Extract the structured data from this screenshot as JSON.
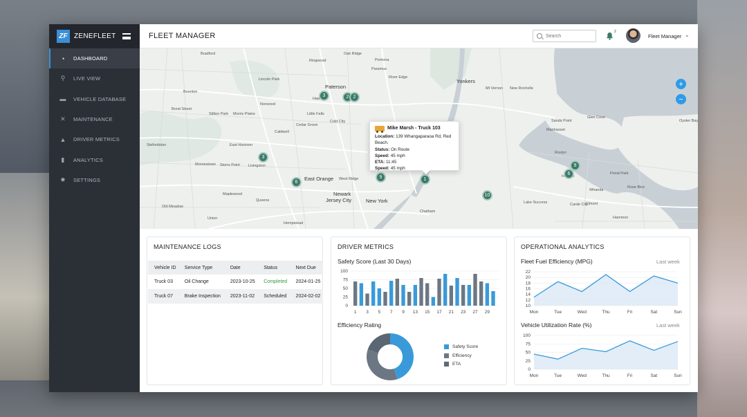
{
  "app": {
    "brand": "ZENEFLEET",
    "logo_text": "ZF",
    "page_title": "FLEET MANAGER"
  },
  "sidebar": {
    "items": [
      {
        "label": "DASHBOARD",
        "icon": "gauge-icon",
        "active": true
      },
      {
        "label": "LIVE VIEW",
        "icon": "route-icon"
      },
      {
        "label": "VEHICLE DATABASE",
        "icon": "truck-icon"
      },
      {
        "label": "MAINTENANCE",
        "icon": "tools-icon"
      },
      {
        "label": "DRIVER METRICS",
        "icon": "flask-icon"
      },
      {
        "label": "ANALYTICS",
        "icon": "bar-chart-icon"
      },
      {
        "label": "SETTINGS",
        "icon": "gear-icon"
      }
    ]
  },
  "header": {
    "search_placeholder": "Search",
    "notification_count": "2",
    "user_name": "Fleet Manager",
    "chevron": "⌄"
  },
  "map": {
    "zoom_in": "+",
    "zoom_out": "−",
    "clusters": [
      "3",
      "2",
      "2",
      "3",
      "6",
      "9",
      "1",
      "10",
      "9",
      "6"
    ],
    "labels": [
      "Bradford",
      "Oak Ridge",
      "Ringwood",
      "Pomona",
      "Paramus",
      "River Edge",
      "Yonkers",
      "Lincoln Park",
      "Paterson",
      "Mt Vernon",
      "New Rochelle",
      "Boonton",
      "Norwood",
      "Bond Street",
      "Stilton Park",
      "Haworth",
      "Little Falls",
      "Morris Plains",
      "Cold City",
      "Caldwell",
      "Cedar Grove",
      "Sands Point",
      "Manhasset",
      "Glen Cove",
      "Oyster Bay",
      "Stefordston",
      "East Hanover",
      "Mornestown",
      "North Bergen",
      "Roslyn",
      "Storrs Point",
      "Livingston",
      "West Ridge",
      "East Orange",
      "Newark",
      "Jersey City",
      "New York",
      "Chatham",
      "Maplewood",
      "Queens",
      "Lake Success",
      "Hewlett",
      "Whanda",
      "Floral Park",
      "Carde City",
      "Elmont",
      "Rose Bice",
      "Old Meadow",
      "Union",
      "Hempstead",
      "Hammon"
    ],
    "popup": {
      "title": "Mike Marsh - Truck 103",
      "location_label": "Location:",
      "location": "139 Whangaparaoa Rd, Red Beach.",
      "status_label": "Status:",
      "status": "On Route",
      "speed_label": "Speed:",
      "speed": "45 mph",
      "eta_label": "ETA:",
      "eta": "11:45",
      "speed2_label": "Speed:",
      "speed2": "45 mph"
    }
  },
  "maintenance": {
    "title": "MAINTENANCE LOGS",
    "columns": [
      "Vehicle ID",
      "Service Type",
      "Date",
      "Status",
      "Next Due"
    ],
    "rows": [
      [
        "Truck 03",
        "Oil Change",
        "2023-10-25",
        "Completed",
        "2024-01-25"
      ],
      [
        "Truck 07",
        "Brake Inspection",
        "2023-11-02",
        "Scheduled",
        "2024-02-02"
      ]
    ],
    "status_colors": {
      "Completed": "#2e9a3c",
      "Scheduled": "#222222"
    }
  },
  "driver_metrics": {
    "title": "DRIVER METRICS",
    "safety_title": "Safety Score (Last 30 Days)",
    "efficiency_title": "Efficiency Rating",
    "legend": [
      {
        "label": "Safety Score",
        "color": "#3a9ad9"
      },
      {
        "label": "Efficiency",
        "color": "#6c7783"
      },
      {
        "label": "ETA",
        "color": "#5e6a76"
      }
    ]
  },
  "operational": {
    "title": "OPERATIONAL ANALYTICS",
    "fuel_title": "Fleet Fuel Efficiency (MPG)",
    "fuel_period": "Last week",
    "util_title": "Vehicle Utilization Rate (%)",
    "util_period": "Last week"
  },
  "colors": {
    "accent": "#3a8fd6",
    "sidebar": "#2b2f36",
    "cluster": "#3c7a6a",
    "bar_blue": "#3a9ad9",
    "bar_gray": "#6c7783",
    "line": "#3a9ad9"
  },
  "chart_data": [
    {
      "type": "bar",
      "title": "Safety Score (Last 30 Days)",
      "x": [
        1,
        2,
        3,
        4,
        5,
        6,
        7,
        8,
        9,
        10,
        11,
        12,
        13,
        14,
        15,
        16,
        17,
        18,
        19,
        20,
        21,
        22,
        23,
        24,
        25,
        26,
        27,
        28,
        29,
        30
      ],
      "x_tick_labels": [
        "1",
        "3",
        "5",
        "7",
        "9",
        "13",
        "15",
        "17",
        "21",
        "23",
        "27",
        "29"
      ],
      "values": [
        70,
        65,
        35,
        70,
        50,
        40,
        72,
        78,
        60,
        40,
        60,
        80,
        65,
        25,
        78,
        92,
        58,
        80,
        60,
        60,
        92,
        70,
        65,
        42
      ],
      "series_colors": [
        "gray",
        "blue",
        "gray",
        "blue",
        "blue",
        "gray",
        "blue",
        "gray",
        "blue",
        "gray",
        "blue",
        "gray",
        "gray",
        "blue",
        "gray",
        "blue",
        "gray",
        "blue",
        "gray",
        "blue",
        "gray",
        "gray",
        "blue",
        "blue"
      ],
      "ylim": [
        0,
        100
      ],
      "yticks": [
        0,
        25,
        50,
        75,
        100
      ]
    },
    {
      "type": "pie",
      "title": "Efficiency Rating",
      "labels": [
        "Safety Score",
        "Efficiency",
        "ETA"
      ],
      "values": [
        45,
        35,
        20
      ],
      "donut": true
    },
    {
      "type": "area",
      "title": "Fleet Fuel Efficiency (MPG)",
      "categories": [
        "Mon",
        "Tue",
        "Wed",
        "Thu",
        "Fri",
        "Sat",
        "Sun"
      ],
      "values": [
        13,
        18.5,
        15,
        21,
        15,
        20.5,
        18
      ],
      "ylim": [
        10,
        22
      ],
      "yticks": [
        10,
        12,
        14,
        16,
        18,
        20,
        22
      ]
    },
    {
      "type": "area",
      "title": "Vehicle Utilization Rate (%)",
      "categories": [
        "Mon",
        "Tue",
        "Wed",
        "Thu",
        "Fri",
        "Sat",
        "Sun"
      ],
      "values": [
        45,
        30,
        62,
        52,
        84,
        56,
        82
      ],
      "ylim": [
        0,
        100
      ],
      "yticks": [
        0,
        25,
        50,
        75,
        100
      ]
    }
  ]
}
